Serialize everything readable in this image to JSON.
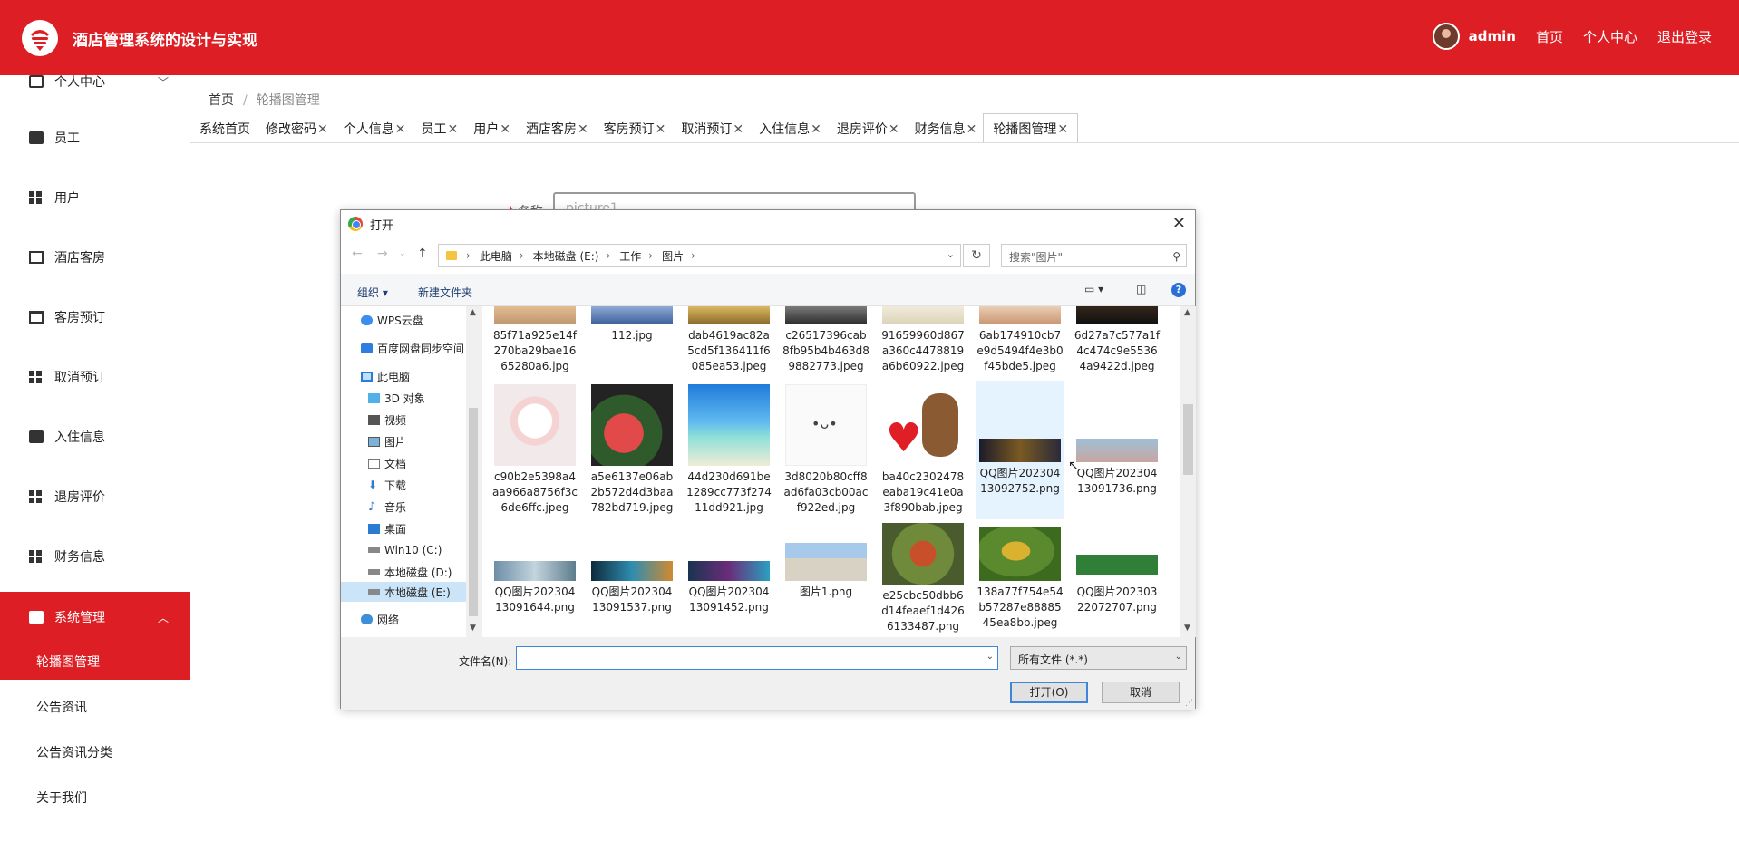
{
  "header": {
    "title": "酒店管理系统的设计与实现",
    "username": "admin",
    "nav": [
      "首页",
      "个人中心",
      "退出登录"
    ]
  },
  "sidebar": {
    "items": [
      {
        "label": "个人中心"
      },
      {
        "label": "员工"
      },
      {
        "label": "用户"
      },
      {
        "label": "酒店客房"
      },
      {
        "label": "客房预订"
      },
      {
        "label": "取消预订"
      },
      {
        "label": "入住信息"
      },
      {
        "label": "退房评价"
      },
      {
        "label": "财务信息"
      },
      {
        "label": "系统管理"
      }
    ],
    "sub_items": [
      {
        "label": "轮播图管理"
      },
      {
        "label": "公告资讯"
      },
      {
        "label": "公告资讯分类"
      },
      {
        "label": "关于我们"
      }
    ]
  },
  "breadcrumb": {
    "home": "首页",
    "sep": "/",
    "current": "轮播图管理"
  },
  "tags": [
    "系统首页",
    "修改密码",
    "个人信息",
    "员工",
    "用户",
    "酒店客房",
    "客房预订",
    "取消预订",
    "入住信息",
    "退房评价",
    "财务信息",
    "轮播图管理"
  ],
  "form": {
    "label": "名称",
    "value": "picture1"
  },
  "dialog": {
    "title": "打开",
    "path": [
      "此电脑",
      "本地磁盘 (E:)",
      "工作",
      "图片"
    ],
    "search_placeholder": "搜索\"图片\"",
    "organize": "组织",
    "new_folder": "新建文件夹",
    "nav_items": [
      {
        "label": "WPS云盘",
        "icon": "cloud-icon"
      },
      {
        "label": "百度网盘同步空间",
        "icon": "baidu-icon"
      },
      {
        "label": "此电脑",
        "icon": "computer-icon"
      },
      {
        "label": "3D 对象",
        "icon": "cube-icon"
      },
      {
        "label": "视频",
        "icon": "video-icon"
      },
      {
        "label": "图片",
        "icon": "picture-icon"
      },
      {
        "label": "文档",
        "icon": "document-icon"
      },
      {
        "label": "下载",
        "icon": "download-icon"
      },
      {
        "label": "音乐",
        "icon": "music-icon"
      },
      {
        "label": "桌面",
        "icon": "desktop-icon"
      },
      {
        "label": "Win10 (C:)",
        "icon": "drive-icon"
      },
      {
        "label": "本地磁盘 (D:)",
        "icon": "drive-icon"
      },
      {
        "label": "本地磁盘 (E:)",
        "icon": "drive-icon"
      },
      {
        "label": "网络",
        "icon": "network-icon"
      }
    ],
    "files_row1": [
      "85f71a925e14f270ba29bae1665280a6.jpg",
      "112.jpg",
      "dab4619ac82a5cd5f136411f6085ea53.jpeg",
      "c26517396cab8fb95b4b463d89882773.jpeg",
      "91659960d867a360c4478819a6b60922.jpeg",
      "6ab174910cb7e9d5494f4e3b0f45bde5.jpeg",
      "6d27a7c577a1f4c474c9e55364a9422d.jpeg"
    ],
    "files_row2": [
      "c90b2e5398a4aa966a8756f3c6de6ffc.jpeg",
      "a5e6137e06ab2b572d4d3baa782bd719.jpeg",
      "44d230d691be1289cc773f27411dd921.jpg",
      "3d8020b80cff8ad6fa03cb00acf922ed.jpg",
      "ba40c2302478eaba19c41e0a3f890bab.jpeg",
      "QQ图片20230413092752.png",
      "QQ图片20230413091736.png"
    ],
    "files_row3": [
      "QQ图片20230413091644.png",
      "QQ图片20230413091537.png",
      "QQ图片20230413091452.png",
      "图片1.png",
      "e25cbc50dbb6d14feaef1d4266133487.png",
      "138a77f754e54b57287e8888545ea8bb.jpeg",
      "QQ图片20230322072707.png"
    ],
    "filename_label": "文件名(N):",
    "filename_value": "",
    "filetype": "所有文件 (*.*)",
    "open_button": "打开(O)",
    "cancel_button": "取消"
  }
}
